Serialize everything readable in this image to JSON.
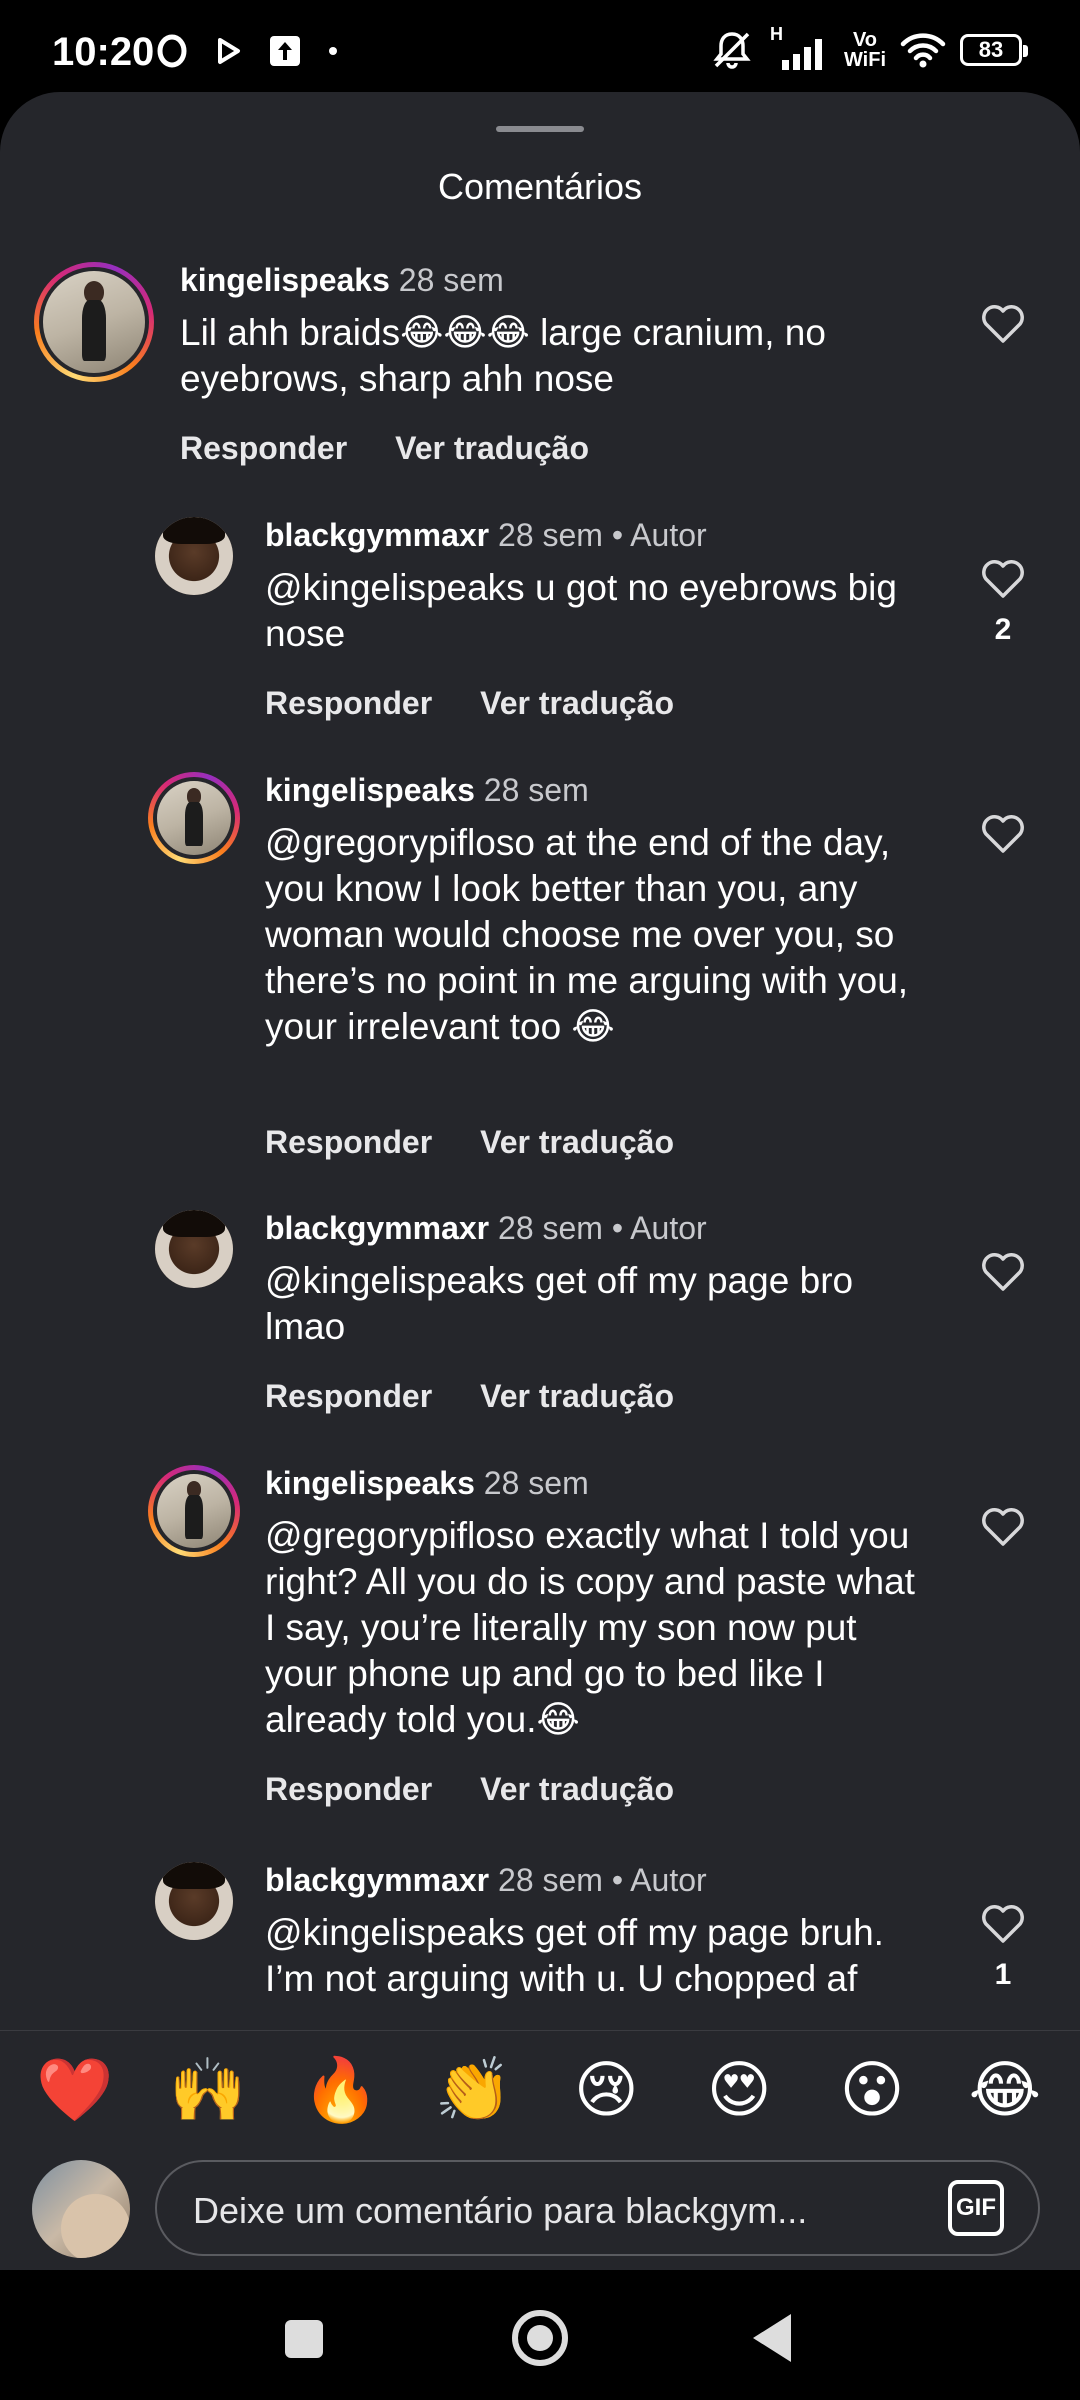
{
  "status_bar": {
    "time": "10:20",
    "battery": "83",
    "network": "H",
    "vowifi_line1": "Vo",
    "vowifi_line2": "WiFi"
  },
  "sheet": {
    "title": "Comentários"
  },
  "comments": [
    {
      "username": "kingelispeaks",
      "time": "28 sem",
      "author_tag": "",
      "text": "Lil ahh braids😂😂😂 large cranium, no eyebrows, sharp ahh nose",
      "reply_label": "Responder",
      "translate_label": "Ver tradução",
      "likes": ""
    },
    {
      "username": "blackgymmaxr",
      "time": "28 sem",
      "author_tag": "• Autor",
      "text": "@kingelispeaks u got no eyebrows big nose",
      "reply_label": "Responder",
      "translate_label": "Ver tradução",
      "likes": "2"
    },
    {
      "username": "kingelispeaks",
      "time": "28 sem",
      "author_tag": "",
      "text": "@gregorypifloso at the end of the day, you know I look better than you, any woman would choose me over you, so there’s no point in me arguing with you, your irrelevant too 😂",
      "reply_label": "Responder",
      "translate_label": "Ver tradução",
      "likes": ""
    },
    {
      "username": "blackgymmaxr",
      "time": "28 sem",
      "author_tag": "• Autor",
      "text": "@kingelispeaks get off my page bro lmao",
      "reply_label": "Responder",
      "translate_label": "Ver tradução",
      "likes": ""
    },
    {
      "username": "kingelispeaks",
      "time": "28 sem",
      "author_tag": "",
      "text": "@gregorypifloso exactly what I told you right? All you do is copy and paste what I say, you’re literally my son now put your phone up and go to bed like I already told you.😂",
      "reply_label": "Responder",
      "translate_label": "Ver tradução",
      "likes": ""
    },
    {
      "username": "blackgymmaxr",
      "time": "28 sem",
      "author_tag": "• Autor",
      "text": "@kingelispeaks get off my page bruh. I’m not arguing with u. U chopped af",
      "reply_label": "",
      "translate_label": "",
      "likes": "1"
    }
  ],
  "emoji_bar": [
    "❤️",
    "🙌",
    "🔥",
    "👏",
    "😢",
    "😍",
    "😮",
    "😂"
  ],
  "composer": {
    "placeholder": "Deixe um comentário para blackgym...",
    "gif_label": "GIF"
  }
}
